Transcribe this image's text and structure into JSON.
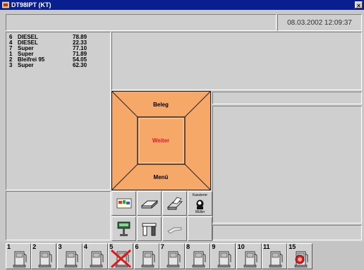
{
  "window": {
    "title": "DT98IPT (KT)",
    "close_glyph": "×"
  },
  "header": {
    "datetime": "08.03.2002 12:09:37"
  },
  "transactions": [
    {
      "pump": "6",
      "product": "DIESEL",
      "amount": "78.89"
    },
    {
      "pump": "4",
      "product": "DIESEL",
      "amount": "22.33"
    },
    {
      "pump": "7",
      "product": "Super",
      "amount": "77.10"
    },
    {
      "pump": "1",
      "product": "Super",
      "amount": "71.89"
    },
    {
      "pump": "2",
      "product": "Bleifrei 95",
      "amount": "54.05"
    },
    {
      "pump": "3",
      "product": "Super",
      "amount": "62.30"
    }
  ],
  "control": {
    "top_label": "Beleg",
    "center_label": "Weiter",
    "bottom_label": "Menü",
    "fill_color": "#f5a868",
    "center_color": "#e8182c"
  },
  "cashier": {
    "label": "Kassierer",
    "name": "Müller"
  },
  "tools": [
    {
      "icon": "card-reader-icon"
    },
    {
      "icon": "receipt-drawer-icon"
    },
    {
      "icon": "printer-icon"
    },
    {
      "icon": "customer-display-icon"
    },
    {
      "icon": "cash-drawer-icon"
    },
    {
      "icon": "nozzle-icon"
    }
  ],
  "pumps": [
    {
      "number": "1",
      "status": "idle"
    },
    {
      "number": "2",
      "status": "idle"
    },
    {
      "number": "3",
      "status": "idle"
    },
    {
      "number": "4",
      "status": "idle"
    },
    {
      "number": "5",
      "status": "disabled"
    },
    {
      "number": "6",
      "status": "idle"
    },
    {
      "number": "7",
      "status": "idle"
    },
    {
      "number": "8",
      "status": "idle"
    },
    {
      "number": "9",
      "status": "idle"
    },
    {
      "number": "10",
      "status": "idle"
    },
    {
      "number": "11",
      "status": "idle"
    },
    {
      "number": "15",
      "status": "alarm"
    }
  ]
}
